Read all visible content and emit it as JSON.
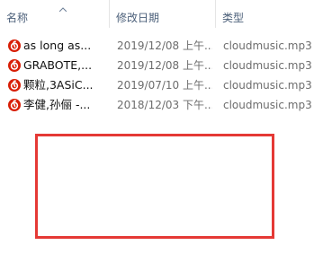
{
  "columns": {
    "name": "名称",
    "date": "修改日期",
    "type": "类型"
  },
  "sort": {
    "column": "name",
    "direction": "ascending",
    "icon": "sort-up-icon"
  },
  "files": [
    {
      "name": "as long as...",
      "date": "2019/12/08 上午...",
      "type": "cloudmusic.mp3",
      "icon": "netease-music-icon"
    },
    {
      "name": "GRABOTE,...",
      "date": "2019/12/08 上午...",
      "type": "cloudmusic.mp3",
      "icon": "netease-music-icon"
    },
    {
      "name": "颗粒,3ASiC...",
      "date": "2019/07/10 上午...",
      "type": "cloudmusic.mp3",
      "icon": "netease-music-icon"
    },
    {
      "name": "李健,孙俪 -...",
      "date": "2018/12/03 下午...",
      "type": "cloudmusic.mp3",
      "icon": "netease-music-icon"
    }
  ],
  "colors": {
    "header_text": "#4c607a",
    "file_icon": "#d81e06",
    "annotation_box": "#e53935"
  }
}
